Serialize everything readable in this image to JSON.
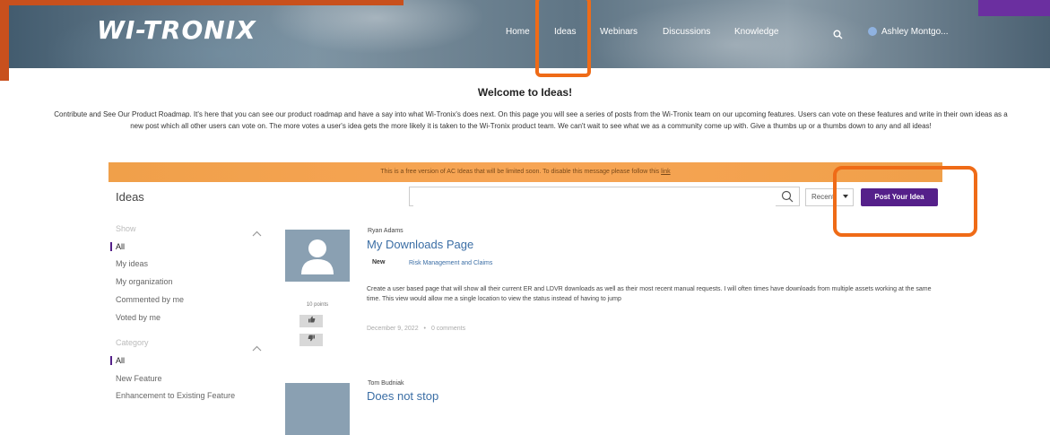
{
  "header": {
    "logo": "WI-TRONIX",
    "nav": [
      {
        "label": "Home"
      },
      {
        "label": "Ideas"
      },
      {
        "label": "Webinars"
      },
      {
        "label": "Discussions"
      },
      {
        "label": "Knowledge"
      }
    ],
    "user_name": "Ashley Montgo..."
  },
  "intro": {
    "title": "Welcome to Ideas!",
    "body": "Contribute and See Our Product Roadmap. It's here that you can see our product roadmap and have a say into what Wi-Tronix's does next. On this page you will see a series of posts from the Wi-Tronix team on our upcoming features. Users can vote on these features and write in their own ideas as a new post which all other users can vote on. The more votes a user's idea gets the more likely it is taken to the Wi-Tronix product team. We can't wait to see what we as a community come up with. Give a thumbs up or a thumbs down to any and all ideas!"
  },
  "banner": {
    "text": "This is a free version of AC Ideas that will be limited soon. To disable this message please follow this",
    "link": "link"
  },
  "toolbar": {
    "title": "Ideas",
    "search_value": "",
    "sort_value": "Recent",
    "post_button": "Post Your Idea"
  },
  "sidebar": {
    "show_heading": "Show",
    "show_items": [
      "All",
      "My ideas",
      "My organization",
      "Commented by me",
      "Voted by me"
    ],
    "category_heading": "Category",
    "category_items": [
      "All",
      "New Feature",
      "Enhancement to Existing Feature"
    ]
  },
  "ideas": [
    {
      "author": "Ryan Adams",
      "title": "My Downloads Page",
      "status": "New",
      "category": "Risk Management and Claims",
      "description": "Create a user based page that will show all their current ER and LDVR downloads as well as their most recent manual requests. I will often times have downloads from multiple assets working at the same time. This view would allow me a single location to view the status instead of having to jump",
      "date": "December 9, 2022",
      "comments": "0 comments",
      "points": "10 points"
    },
    {
      "author": "Tom Budniak",
      "title": "Does not stop"
    }
  ],
  "colors": {
    "accent_purple": "#55208a",
    "highlight_orange": "#ef6b17",
    "banner_orange": "#f7a555",
    "link_blue": "#3b6ea5"
  }
}
